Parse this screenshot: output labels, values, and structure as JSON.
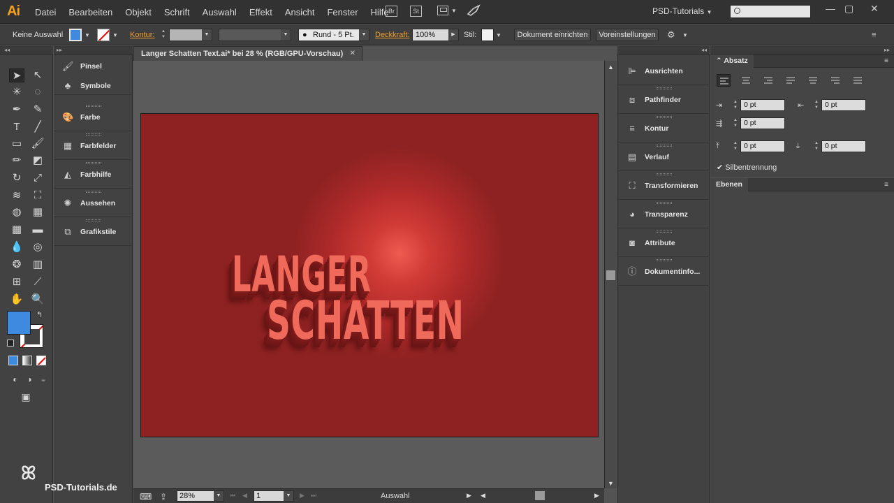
{
  "app": {
    "logo": "Ai",
    "workspace": "PSD-Tutorials"
  },
  "menu": [
    "Datei",
    "Bearbeiten",
    "Objekt",
    "Schrift",
    "Auswahl",
    "Effekt",
    "Ansicht",
    "Fenster",
    "Hilfe"
  ],
  "appbuttons": {
    "bridge": "Br",
    "stock": "St"
  },
  "control": {
    "selection": "Keine Auswahl",
    "kontur_label": "Kontur:",
    "brush": "Rund - 5 Pt.",
    "deckkraft_label": "Deckkraft:",
    "deckkraft_value": "100%",
    "stil_label": "Stil:",
    "doc_setup": "Dokument einrichten",
    "preferences": "Voreinstellungen"
  },
  "colors": {
    "fill": "#3d8ae0",
    "artboard": "#8e2222",
    "text": "#ef6a5a"
  },
  "document": {
    "tab_title": "Langer Schatten Text.ai* bei 28 % (RGB/GPU-Vorschau)",
    "line1": "LANGER",
    "line2": "SCHATTEN"
  },
  "panels_left": [
    "Pinsel",
    "Symbole",
    "Farbe",
    "Farbfelder",
    "Farbhilfe",
    "Aussehen",
    "Grafikstile"
  ],
  "panels_right": [
    "Ausrichten",
    "Pathfinder",
    "Kontur",
    "Verlauf",
    "Transformieren",
    "Transparenz",
    "Attribute",
    "Dokumentinfo..."
  ],
  "absatz": {
    "title": "Absatz",
    "left_indent": "0 pt",
    "right_indent": "0 pt",
    "first_line": "0 pt",
    "space_before": "0 pt",
    "space_after": "0 pt",
    "hyphenation": "Silbentrennung"
  },
  "ebenen": {
    "title": "Ebenen"
  },
  "status": {
    "zoom": "28%",
    "page": "1",
    "mode": "Auswahl"
  },
  "branding": {
    "text": "PSD-Tutorials.de"
  }
}
